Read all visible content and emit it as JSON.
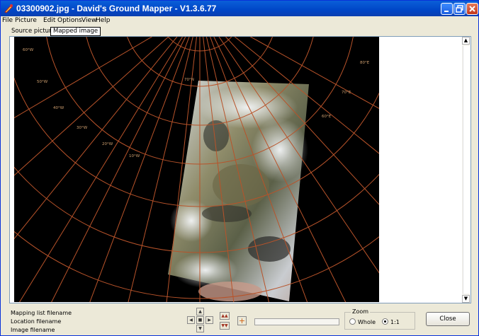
{
  "window": {
    "title": "03300902.jpg - David's Ground Mapper - V1.3.6.77"
  },
  "menu": {
    "items": [
      "File",
      "Picture",
      "Edit",
      "Options",
      "View",
      "Help"
    ]
  },
  "tabs": {
    "source": "Source picture",
    "mapped": "Mapped image",
    "active": "mapped"
  },
  "map": {
    "longitude_labels": [
      "60°W",
      "50°W",
      "40°W",
      "30°W",
      "20°W",
      "10°W",
      "80°E",
      "70°E",
      "60°E"
    ],
    "latitude_label": "70°N",
    "grid_color": "#c05a2c"
  },
  "status": {
    "mapping_list": "Mapping list filename",
    "location": "Location filename",
    "image": "Image filename"
  },
  "zoom": {
    "title": "Zoom",
    "options": [
      "Whole",
      "1:1"
    ],
    "selected": "1:1"
  },
  "buttons": {
    "close": "Close"
  }
}
